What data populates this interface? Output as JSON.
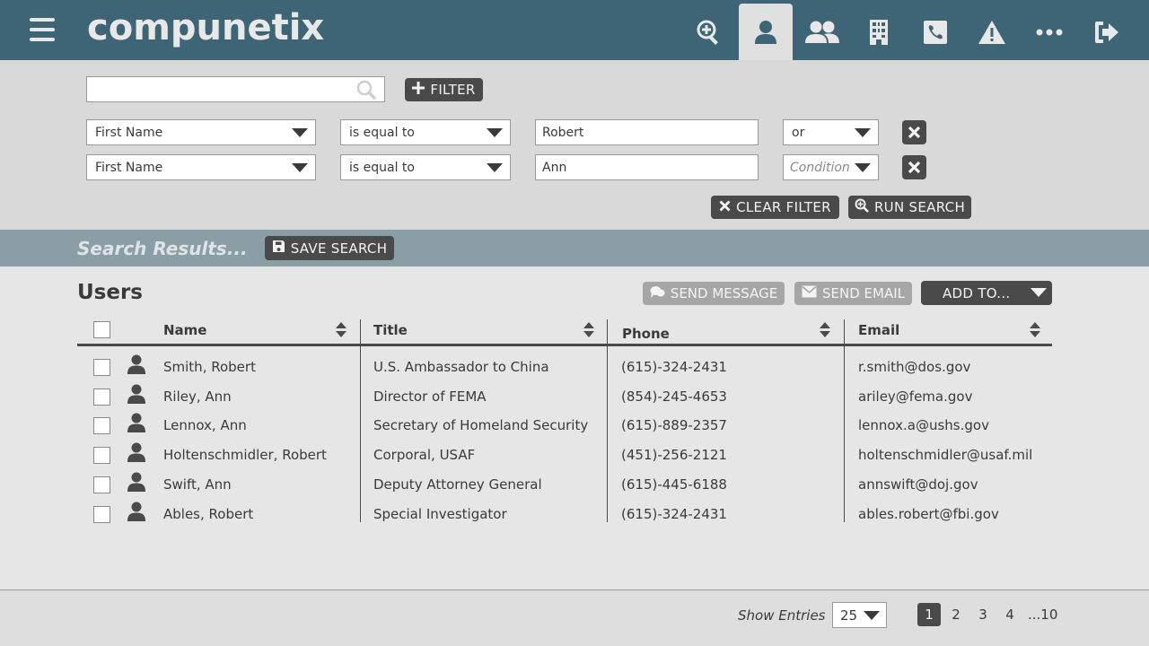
{
  "app": {
    "logo": "compunetix"
  },
  "nav": {
    "items": [
      "menu",
      "search-user",
      "user",
      "users-group",
      "building",
      "phone",
      "alert",
      "more",
      "logout"
    ]
  },
  "filter": {
    "search_placeholder": "",
    "filter_button": "FILTER",
    "rows": [
      {
        "field": "First Name",
        "operator": "is equal to",
        "value": "Robert",
        "condition": "or"
      },
      {
        "field": "First Name",
        "operator": "is equal to",
        "value": "Ann",
        "condition": "Condition"
      }
    ],
    "clear_button": "CLEAR FILTER",
    "run_button": "RUN SEARCH"
  },
  "results": {
    "title": "Search Results...",
    "save_button": "SAVE SEARCH"
  },
  "users": {
    "title": "Users",
    "send_message": "SEND MESSAGE",
    "send_email": "SEND EMAIL",
    "add_to": "ADD TO...",
    "columns": {
      "name": "Name",
      "title": "Title",
      "phone": "Phone",
      "email": "Email"
    },
    "rows": [
      {
        "name": "Smith, Robert",
        "title": "U.S. Ambassador to China",
        "phone": "(615)-324-2431",
        "email": "r.smith@dos.gov"
      },
      {
        "name": "Riley, Ann",
        "title": "Director of FEMA",
        "phone": "(854)-245-4653",
        "email": "ariley@fema.gov"
      },
      {
        "name": "Lennox, Ann",
        "title": "Secretary of Homeland Security",
        "phone": "(615)-889-2357",
        "email": "lennox.a@ushs.gov"
      },
      {
        "name": "Holtenschmidler, Robert",
        "title": "Corporal, USAF",
        "phone": "(451)-256-2121",
        "email": "holtenschmidler@usaf.mil"
      },
      {
        "name": "Swift, Ann",
        "title": "Deputy Attorney General",
        "phone": "(615)-445-6188",
        "email": "annswift@doj.gov"
      },
      {
        "name": "Ables, Robert",
        "title": "Special Investigator",
        "phone": "(615)-324-2431",
        "email": "ables.robert@fbi.gov"
      }
    ]
  },
  "footer": {
    "show_entries_label": "Show Entries",
    "entries_value": "25",
    "pages": [
      "1",
      "2",
      "3",
      "4",
      "...10"
    ],
    "current_page": "1"
  },
  "colors": {
    "header": "#3d6575",
    "dark_button": "#4a4a4a",
    "results_bar": "#8a9ea6"
  }
}
